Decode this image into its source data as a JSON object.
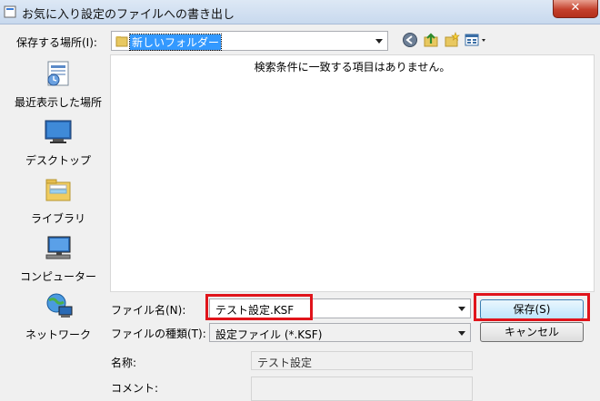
{
  "window": {
    "title": "お気に入り設定のファイルへの書き出し",
    "close_label": "✕"
  },
  "save_location": {
    "label": "保存する場所(I):",
    "folder": "新しいフォルダー"
  },
  "toolbar": {
    "back_icon": "back-arrow-icon",
    "up_icon": "up-folder-icon",
    "new_folder_icon": "new-folder-icon",
    "view_icon": "view-menu-icon"
  },
  "places": [
    {
      "label": "最近表示した場所",
      "icon": "recent-places-icon"
    },
    {
      "label": "デスクトップ",
      "icon": "desktop-icon"
    },
    {
      "label": "ライブラリ",
      "icon": "libraries-icon"
    },
    {
      "label": "コンピューター",
      "icon": "computer-icon"
    },
    {
      "label": "ネットワーク",
      "icon": "network-icon"
    }
  ],
  "file_list": {
    "empty_message": "検索条件に一致する項目はありません。"
  },
  "filename": {
    "label": "ファイル名(N):",
    "value": "テスト設定.KSF"
  },
  "filetype": {
    "label": "ファイルの種類(T):",
    "value": "設定ファイル (*.KSF)"
  },
  "buttons": {
    "save": "保存(S)",
    "cancel": "キャンセル"
  },
  "meta": {
    "name_label": "名称:",
    "name_value": "テスト設定",
    "comment_label": "コメント:",
    "comment_value": ""
  },
  "colors": {
    "highlight": "#e0141b",
    "selection": "#3399ff"
  }
}
